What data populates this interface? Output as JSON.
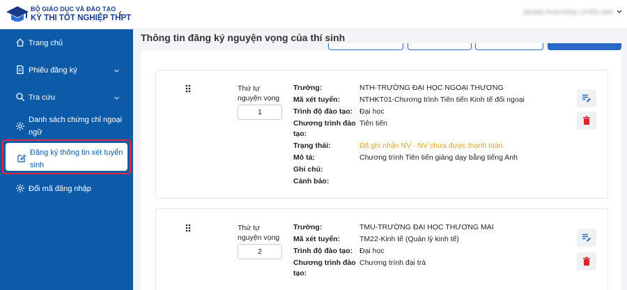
{
  "brand": {
    "line1": "BỘ GIÁO DỤC VÀ ĐÀO TẠO",
    "line2": "KỲ THI TỐT NGHIỆP THPT"
  },
  "user": {
    "name": "ĐOÀN PHƯƠNG UYÊN NHI"
  },
  "sidebar": {
    "items": [
      {
        "label": "Trang chủ"
      },
      {
        "label": "Phiếu đăng ký"
      },
      {
        "label": "Tra cứu"
      },
      {
        "label_line1": "Danh sách chứng chỉ ngoại",
        "label_line2": "ngữ"
      },
      {
        "label_line1": "Đăng ký thông tin xét tuyển",
        "label_line2": "sinh"
      },
      {
        "label": "Đổi mã đăng nhập"
      }
    ]
  },
  "main": {
    "title": "Thông tin đăng ký nguyện vọng của thí sinh",
    "order_label_line1": "Thứ tự",
    "order_label_line2": "nguyện vọng",
    "labels": {
      "truong": "Trường:",
      "ma": "Mã xét tuyển:",
      "trinhdo": "Trình độ đào tạo:",
      "chuongtrinh_line1": "Chương trình đào",
      "chuongtrinh_line2": "tạo:",
      "trangthai": "Trạng thái:",
      "mota": "Mô tả:",
      "ghichu": "Ghi chú:",
      "canhbao": "Cảnh báo:"
    },
    "cards": [
      {
        "order": "1",
        "truong": "NTH-TRƯỜNG ĐẠI HỌC NGOẠI THƯƠNG",
        "ma": "NTHKT01-Chương trình Tiên tiến Kinh tế đối ngoại",
        "trinhdo": "Đại học",
        "chuongtrinh": "Tiên tiến",
        "trangthai": "Đã ghi nhận NV - NV chưa được thanh toán",
        "mota": "Chương trình Tiên tiến giảng dạy bằng tiếng Anh",
        "ghichu": "",
        "canhbao": ""
      },
      {
        "order": "2",
        "truong": "TMU-TRƯỜNG ĐẠI HỌC THƯƠNG MẠI",
        "ma": "TM22-Kinh tế (Quản lý kinh tế)",
        "trinhdo": "Đại học",
        "chuongtrinh": "Chương trình đại trà"
      }
    ]
  },
  "colors": {
    "sidebar": "#0d5ba8",
    "highlight": "#e5283a",
    "status": "#e6a21f",
    "delete": "#d9262b",
    "edit": "#2a68c8"
  },
  "icons": [
    "graduation-cap-icon",
    "chevron-left-icon",
    "home-icon",
    "document-icon",
    "search-icon",
    "gear-icon",
    "edit-icon",
    "delete-icon",
    "drag-handle-icon",
    "chevron-down-icon"
  ]
}
